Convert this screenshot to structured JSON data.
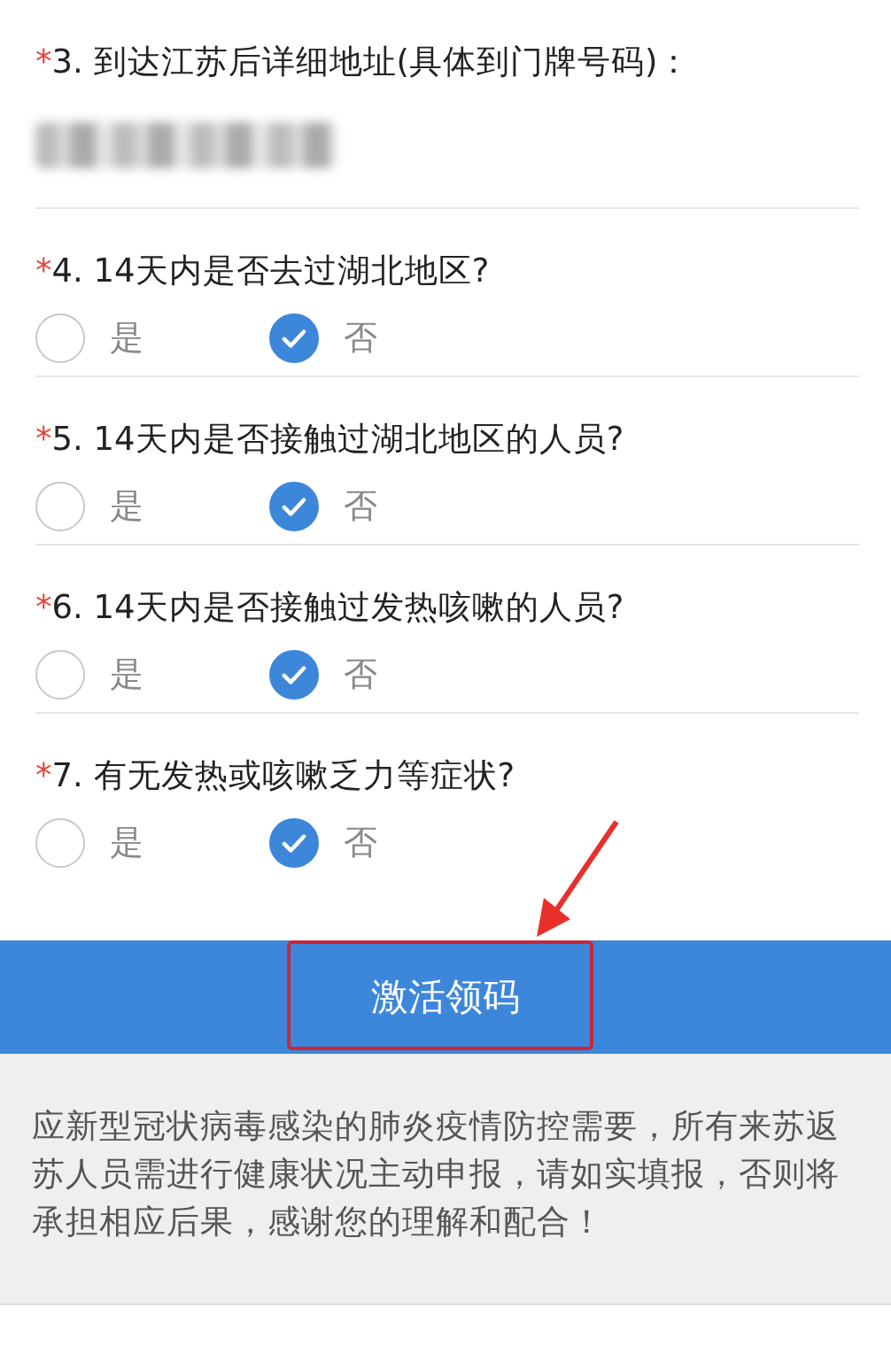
{
  "questions": [
    {
      "kind": "address",
      "required": true,
      "marker": "*",
      "label": "3. 到达江苏后详细地址(具体到门牌号码)：",
      "redacted": true
    },
    {
      "kind": "choice",
      "required": true,
      "marker": "*",
      "label": "4. 14天内是否去过湖北地区?",
      "options": [
        {
          "label": "是",
          "selected": false
        },
        {
          "label": "否",
          "selected": true
        }
      ]
    },
    {
      "kind": "choice",
      "required": true,
      "marker": "*",
      "label": "5. 14天内是否接触过湖北地区的人员?",
      "options": [
        {
          "label": "是",
          "selected": false
        },
        {
          "label": "否",
          "selected": true
        }
      ]
    },
    {
      "kind": "choice",
      "required": true,
      "marker": "*",
      "label": "6. 14天内是否接触过发热咳嗽的人员?",
      "options": [
        {
          "label": "是",
          "selected": false
        },
        {
          "label": "否",
          "selected": true
        }
      ]
    },
    {
      "kind": "choice",
      "required": true,
      "marker": "*",
      "label": "7. 有无发热或咳嗽乏力等症状?",
      "options": [
        {
          "label": "是",
          "selected": false
        },
        {
          "label": "否",
          "selected": true
        }
      ]
    }
  ],
  "submit_button": {
    "label": "激活领码"
  },
  "annotation": {
    "highlight_box": true,
    "arrow": true
  },
  "notice": "应新型冠状病毒感染的肺炎疫情防控需要，所有来苏返苏人员需进行健康状况主动申报，请如实填报，否则将承担相应后果，感谢您的理解和配合！"
}
